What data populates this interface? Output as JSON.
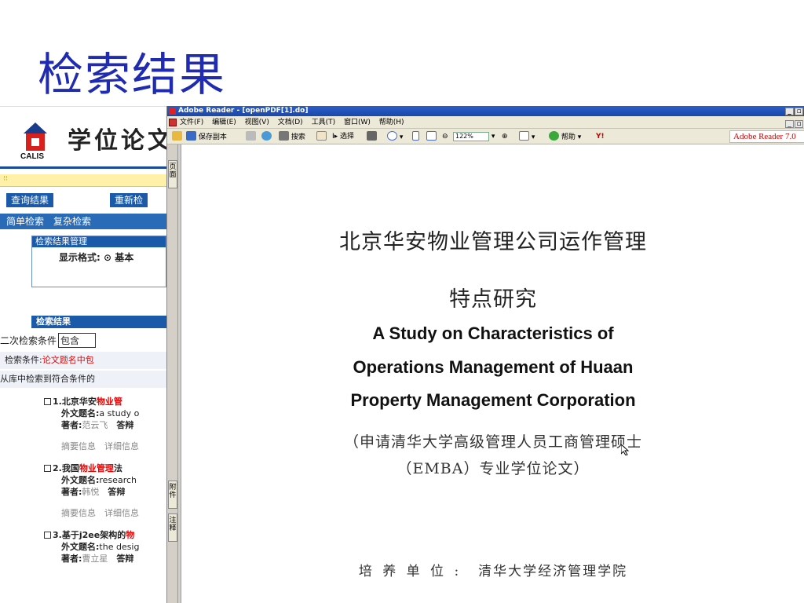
{
  "slide": {
    "title": "检索结果"
  },
  "web": {
    "calis": "CALIS",
    "site_title": "学位论文",
    "buttons": [
      "查询结果",
      "重新检"
    ],
    "subnav": "简单检索　复杂检索",
    "panel_title": "检索结果管理",
    "display_format": "显示格式: ⊙ 基本",
    "results_header": "检索结果",
    "secondary_label": "二次检索条件",
    "secondary_value": "包含",
    "condition_prefix": "检索条件:",
    "condition_value": "论文题名中包",
    "found_text": "从库中检索到符合条件的",
    "items": [
      {
        "num": "1.",
        "pre": "北京华安",
        "hl": "物业管",
        "post": "",
        "foreign_label": "外文题名:",
        "foreign_value": "a study o",
        "author_label": "著者:",
        "author_value": "范云飞",
        "defense_label": "答辩"
      },
      {
        "num": "2.",
        "pre": "我国",
        "hl": "物业管理",
        "post": "法",
        "foreign_label": "外文题名:",
        "foreign_value": "research",
        "author_label": "著者:",
        "author_value": "韩悦",
        "defense_label": "答辩"
      },
      {
        "num": "3.",
        "pre": "基于j2ee架构的",
        "hl": "物",
        "post": "",
        "foreign_label": "外文题名:",
        "foreign_value": "the desig",
        "author_label": "著者:",
        "author_value": "曹立星",
        "defense_label": "答辩"
      }
    ],
    "item_links": "摘要信息　详细信息"
  },
  "reader": {
    "title": "Adobe Reader - [openPDF[1].do]",
    "menu": [
      "文件(F)",
      "编辑(E)",
      "视图(V)",
      "文档(D)",
      "工具(T)",
      "窗口(W)",
      "帮助(H)"
    ],
    "toolbar": {
      "save_copy": "保存副本",
      "search": "搜索",
      "select": "选择",
      "zoom": "122%",
      "help": "帮助",
      "adobe_logo": "Adobe Reader 7.0"
    },
    "sidebar_tabs": [
      "页面",
      "附件",
      "注释"
    ]
  },
  "doc": {
    "title_cn_1": "北京华安物业管理公司运作管理",
    "title_cn_2": "特点研究",
    "title_en_1": "A Study on Characteristics of",
    "title_en_2": "Operations Management of Huaan",
    "title_en_3": "Property Management Corporation",
    "sub_1": "（申请清华大学高级管理人员工商管理硕士",
    "sub_2": "（EMBA）专业学位论文）",
    "unit_label": "培 养 单 位 :",
    "unit_value": "清华大学经济管理学院"
  }
}
